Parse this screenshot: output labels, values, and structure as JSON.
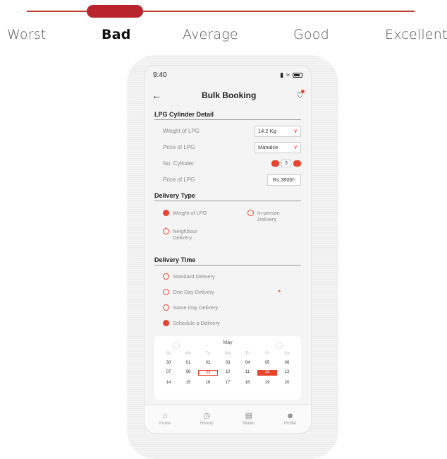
{
  "rating": {
    "labels": [
      "Worst",
      "Bad",
      "Average",
      "Good",
      "Excellent"
    ],
    "selected": "Bad",
    "level": 2
  },
  "status": {
    "time": "9:40"
  },
  "header": {
    "title": "Bulk Booking"
  },
  "lpg": {
    "section_title": "LPG Cylinder Detail",
    "weight_label": "Weight of LPG",
    "weight_value": "14.2 Kg",
    "price_label": "Price of LPG",
    "price_select": "Manalce",
    "cyl_label": "No. Cylinder",
    "cyl_value": "3",
    "price2_label": "Price of LPG",
    "price2_value": "Rs.3600/-"
  },
  "delivery_type": {
    "section_title": "Delivery Type",
    "options": [
      "Weight of LPG",
      "In-person Delivery",
      "Neighbour Delivery"
    ]
  },
  "delivery_time": {
    "section_title": "Delivery Time",
    "options": [
      "Standard Delivery",
      "One Day Delivery",
      "Same Day Delivery",
      "Schedule a Delivery"
    ]
  },
  "calendar": {
    "month": "May",
    "weekdays": [
      "Su",
      "Mo",
      "Tu",
      "We",
      "Th",
      "Fr",
      "Sa"
    ],
    "rows": [
      [
        "30",
        "01",
        "02",
        "03",
        "04",
        "05",
        "06"
      ],
      [
        "07",
        "08",
        "09",
        "10",
        "11",
        "12",
        "13"
      ],
      [
        "14",
        "15",
        "16",
        "17",
        "18",
        "19",
        "20"
      ]
    ],
    "today": "09",
    "selected": "12"
  },
  "tabs": [
    "Home",
    "History",
    "Wallet",
    "Profile"
  ],
  "colors": {
    "accent": "#e8452f",
    "scale": "#b8242c"
  }
}
